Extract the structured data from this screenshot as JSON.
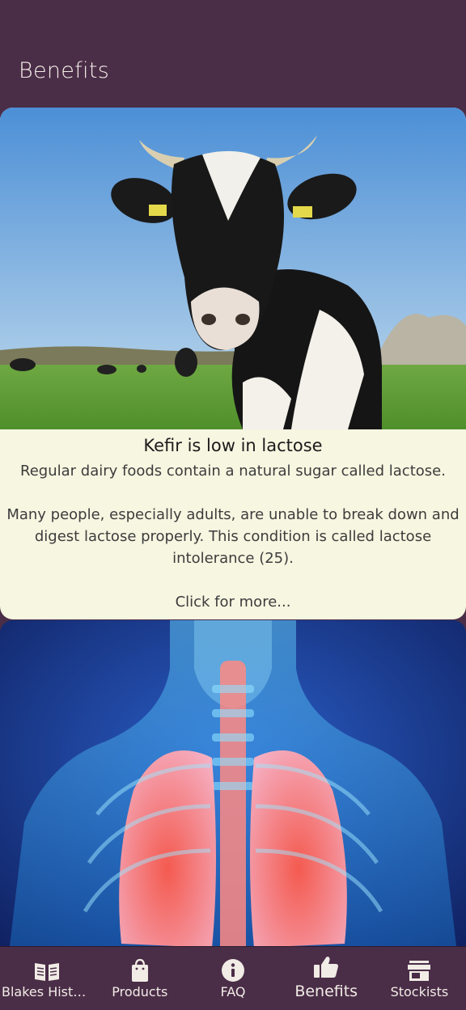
{
  "appbar": {
    "title": "Benefits"
  },
  "cards": [
    {
      "title": "Kefir is low in lactose",
      "body": "Regular dairy foods contain a natural sugar called lactose.\n\nMany people, especially adults, are unable to break down and digest lactose properly. This condition is called lactose intolerance (25).",
      "more": "Click for more..."
    }
  ],
  "nav": {
    "items": [
      {
        "label": "Blakes Histo...",
        "icon": "book-icon"
      },
      {
        "label": "Products",
        "icon": "shopping-bag-icon"
      },
      {
        "label": "FAQ",
        "icon": "info-icon"
      },
      {
        "label": "Benefits",
        "icon": "thumbs-up-icon",
        "active": true
      },
      {
        "label": "Stockists",
        "icon": "store-icon"
      }
    ]
  },
  "colors": {
    "primary": "#4a2d47",
    "card_bg": "#f7f6e1",
    "nav_text": "#f1ece6"
  }
}
